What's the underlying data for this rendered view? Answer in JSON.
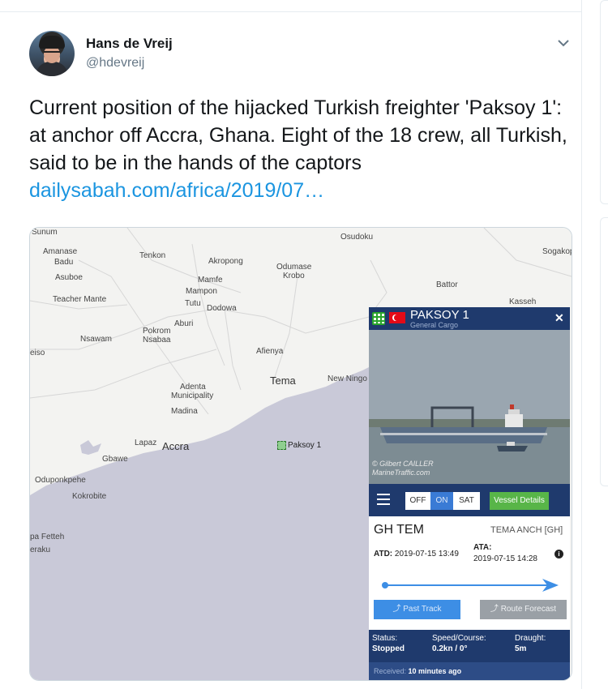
{
  "tweet": {
    "author_name": "Hans de Vreij",
    "author_handle": "@hdevreij",
    "text": "Current position of the hijacked Turkish freighter 'Paksoy 1': at anchor off Accra, Ghana. Eight of the 18 crew, all Turkish, said to be in the hands of the captors",
    "link": "dailysabah.com/africa/2019/07…"
  },
  "icons": {
    "caret": "chevron-down-icon",
    "grid": "grid-icon",
    "flag": "turkey-flag-icon",
    "close": "close-icon",
    "menu": "hamburger-menu-icon",
    "info": "info-icon"
  },
  "colors": {
    "link": "#1b95e0",
    "panel": "#1f3a6d",
    "sea": "#c9c9d8",
    "vessel_details": "#58b548",
    "past_track": "#3d8ee5"
  },
  "map": {
    "places": [
      {
        "name": "Sunum"
      },
      {
        "name": "Osudoku"
      },
      {
        "name": "Sogakop"
      },
      {
        "name": "Amanase"
      },
      {
        "name": "Badu"
      },
      {
        "name": "Tenkon"
      },
      {
        "name": "Akropong"
      },
      {
        "name": "Odumase"
      },
      {
        "name": "Krobo"
      },
      {
        "name": "Asuboe"
      },
      {
        "name": "Mamfe"
      },
      {
        "name": "Mampon"
      },
      {
        "name": "Battor"
      },
      {
        "name": "Teacher Mante"
      },
      {
        "name": "Tutu"
      },
      {
        "name": "Dodowa"
      },
      {
        "name": "Kasseh"
      },
      {
        "name": "Aburi"
      },
      {
        "name": "Pokrom"
      },
      {
        "name": "Nsabaa"
      },
      {
        "name": "Nsawam"
      },
      {
        "name": "eiso"
      },
      {
        "name": "Afienya"
      },
      {
        "name": "Tema"
      },
      {
        "name": "New Ningo"
      },
      {
        "name": "Adenta"
      },
      {
        "name": "Municipality"
      },
      {
        "name": "Madina"
      },
      {
        "name": "Lapaz"
      },
      {
        "name": "Accra"
      },
      {
        "name": "Gbawe"
      },
      {
        "name": "Oduponkpehe"
      },
      {
        "name": "Kokrobite"
      },
      {
        "name": "pa Fetteh"
      },
      {
        "name": "eraku"
      }
    ],
    "vessel_label": "Paksoy 1"
  },
  "panel": {
    "vessel_name": "PAKSOY 1",
    "vessel_type": "General Cargo",
    "photo_credit_1": "© Gilbert CAILLER",
    "photo_credit_2": "MarineTraffic.com",
    "toggle": {
      "off": "OFF",
      "on": "ON",
      "sat": "SAT"
    },
    "vessel_details_label": "Vessel Details",
    "port_code": "GH TEM",
    "port_destination": "TEMA ANCH [GH]",
    "atd_label": "ATD:",
    "atd_value": "2019-07-15 13:49",
    "ata_label": "ATA:",
    "ata_value": "2019-07-15 14:28",
    "past_track_label": "Past Track",
    "route_forecast_label": "Route Forecast",
    "status_label": "Status:",
    "status_value": "Stopped",
    "speed_label": "Speed/Course:",
    "speed_value": "0.2kn / 0°",
    "draught_label": "Draught:",
    "draught_value": "5m",
    "received_label": "Received:",
    "received_value": "10 minutes ago"
  }
}
